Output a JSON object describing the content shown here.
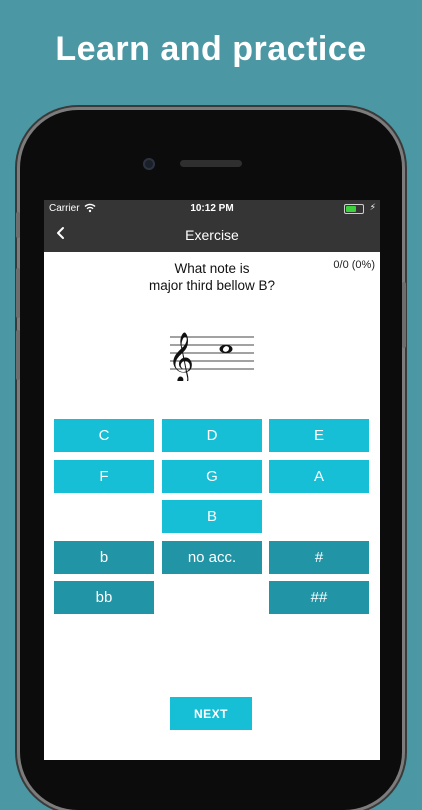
{
  "headline": "Learn and practice",
  "status_bar": {
    "carrier": "Carrier",
    "time": "10:12 PM",
    "battery_level": 0.6,
    "charging": true
  },
  "nav": {
    "back_icon": "chevron-left-icon",
    "title": "Exercise"
  },
  "exercise": {
    "score": "0/0 (0%)",
    "question_line1": "What note is",
    "question_line2": "major third bellow B?",
    "staff": {
      "clef": "treble",
      "clef_glyph": "𝄞",
      "note": "B4",
      "note_type": "whole"
    }
  },
  "note_buttons": [
    "C",
    "D",
    "E",
    "F",
    "G",
    "A",
    "B"
  ],
  "accidental_buttons": [
    "b",
    "no acc.",
    "#",
    "bb",
    "##"
  ],
  "next_label": "NEXT",
  "colors": {
    "background": "#4b98a4",
    "bar": "#353535",
    "note_button": "#17bfd6",
    "accidental_button": "#2194a6"
  }
}
